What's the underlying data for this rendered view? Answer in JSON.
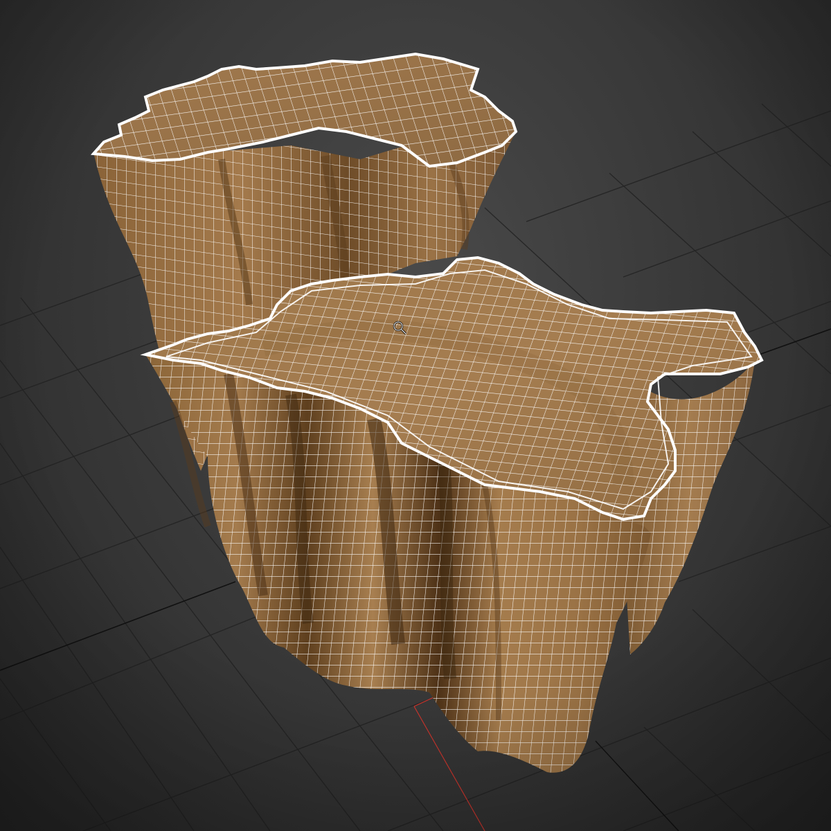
{
  "viewport": {
    "shading_mode": "wireframe-on-shaded",
    "background_color": "#2f2f2f",
    "grid_color": "#222222",
    "object_color": "#a97f52",
    "wire_color": "#ffffff",
    "axis_x_color": "#c8342c"
  },
  "scene": {
    "objects": [
      "stump-table-back",
      "stump-table-front"
    ]
  },
  "cursor": {
    "icon": "zoom-magnifier-icon"
  }
}
